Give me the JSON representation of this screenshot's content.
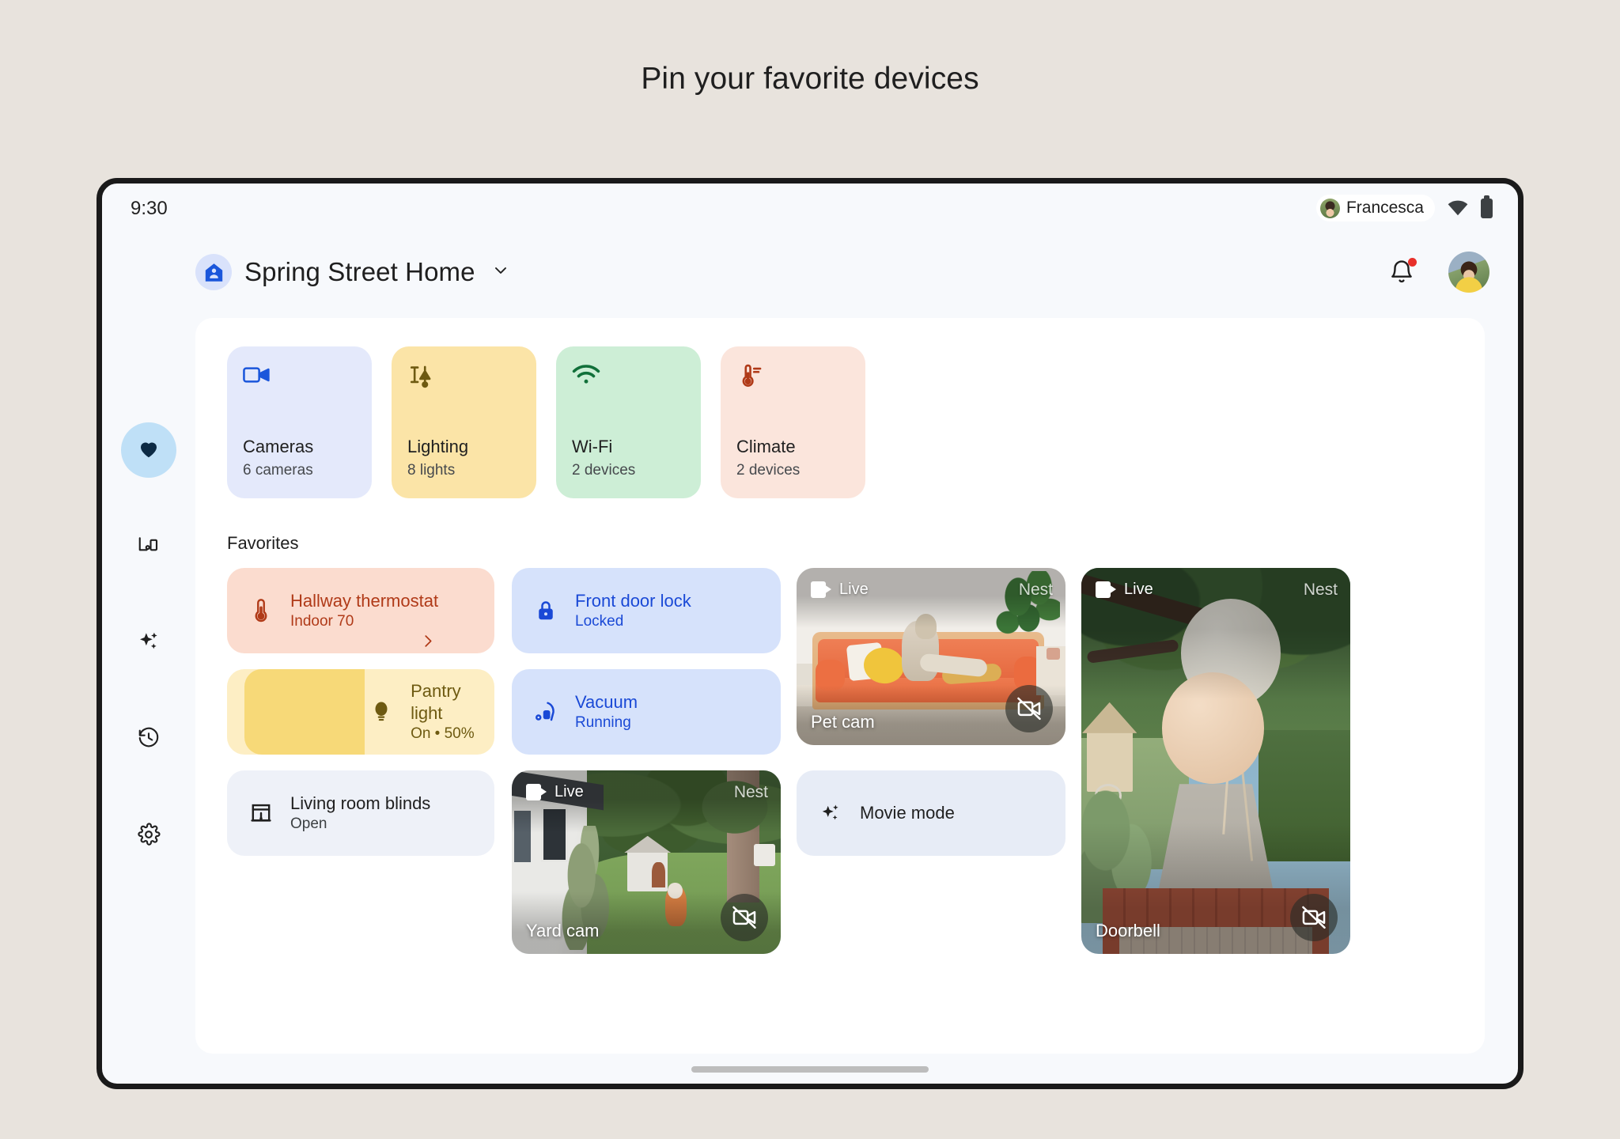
{
  "page": {
    "title": "Pin your favorite devices"
  },
  "status_bar": {
    "time": "9:30",
    "user_name": "Francesca",
    "wifi_icon": "wifi-icon",
    "battery_icon": "battery-icon"
  },
  "app_bar": {
    "home_icon": "home-person-icon",
    "home_name": "Spring Street Home",
    "dropdown_icon": "chevron-down-icon",
    "notifications_icon": "bell-icon",
    "has_notification_badge": true,
    "account_avatar": "user-avatar"
  },
  "nav_rail": {
    "items": [
      {
        "name": "favorites",
        "icon": "heart-icon",
        "active": true
      },
      {
        "name": "devices",
        "icon": "devices-icon",
        "active": false
      },
      {
        "name": "automations",
        "icon": "sparkle-icon",
        "active": false
      },
      {
        "name": "activity",
        "icon": "history-clock-icon",
        "active": false
      },
      {
        "name": "settings",
        "icon": "gear-icon",
        "active": false
      }
    ]
  },
  "categories": [
    {
      "label": "Cameras",
      "sub": "6 cameras",
      "icon": "video-camera-icon",
      "bg": "#e4e9fb",
      "fg": "#1a56db"
    },
    {
      "label": "Lighting",
      "sub": "8 lights",
      "icon": "lamp-slider-icon",
      "bg": "#fbe4a7",
      "fg": "#6e5a11"
    },
    {
      "label": "Wi-Fi",
      "sub": "2 devices",
      "icon": "wifi-icon",
      "bg": "#cdeed6",
      "fg": "#11703a"
    },
    {
      "label": "Climate",
      "sub": "2 devices",
      "icon": "thermometer-icon",
      "bg": "#fbe5dc",
      "fg": "#b03a18"
    }
  ],
  "favorites": {
    "section_label": "Favorites",
    "devices": [
      {
        "name": "Hallway thermostat",
        "state": "Indoor 70",
        "icon": "thermometer-icon",
        "bg": "#fbdccf",
        "fg": "#b03a18",
        "chevron": true
      },
      {
        "name": "Front door lock",
        "state": "Locked",
        "icon": "lock-closed-icon",
        "bg": "#d6e2fb",
        "fg": "#1a49d6",
        "chevron": false
      },
      {
        "name": "Pantry light",
        "state": "On • 50%",
        "icon": "lightbulb-icon",
        "bg": "#fdeec4",
        "fg": "#6e5a11",
        "slider_fill": "#f8d濃",
        "slider_percent": 50,
        "slider_color": "#f7d978",
        "chevron": false
      },
      {
        "name": "Vacuum",
        "state": "Running",
        "icon": "vacuum-icon",
        "bg": "#d6e2fb",
        "fg": "#1a49d6",
        "chevron": false
      },
      {
        "name": "Living room blinds",
        "state": "Open",
        "icon": "blinds-icon",
        "bg": "#eef1f8",
        "fg": "#1f1f1f",
        "chevron": false
      },
      {
        "name": "Movie mode",
        "state": "",
        "icon": "sparkle-icon",
        "bg": "#e7ecf6",
        "fg": "#1f1f1f",
        "chevron": false
      }
    ],
    "cameras": [
      {
        "name": "Pet cam",
        "live_label": "Live",
        "brand": "Nest",
        "off_icon": "camera-off-icon"
      },
      {
        "name": "Yard cam",
        "live_label": "Live",
        "brand": "Nest",
        "off_icon": "camera-off-icon"
      },
      {
        "name": "Doorbell",
        "live_label": "Live",
        "brand": "Nest",
        "off_icon": "camera-off-icon"
      }
    ]
  },
  "gesture_bar": "home-handle"
}
